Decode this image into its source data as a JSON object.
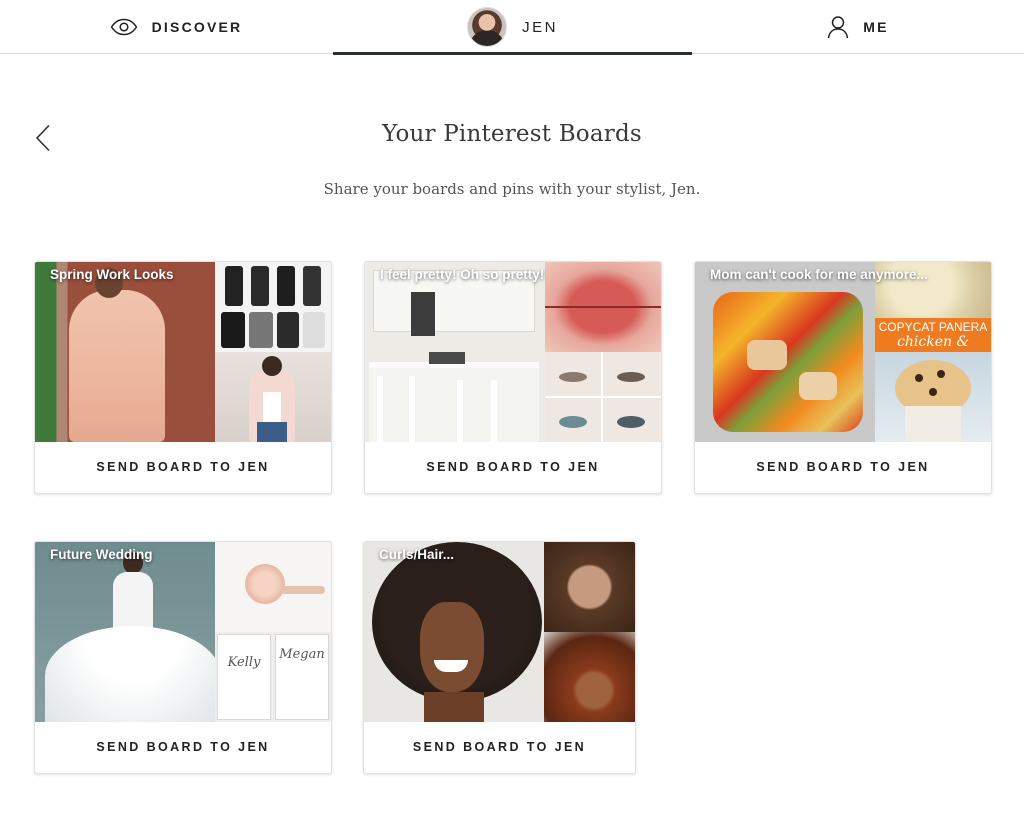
{
  "nav": {
    "discover_label": "DISCOVER",
    "jen_label": "JEN",
    "me_label": "ME",
    "discover_icon": "eye-icon",
    "me_icon": "person-icon",
    "active_tab": "JEN"
  },
  "header": {
    "title": "Your Pinterest Boards",
    "subtitle": "Share your boards and pins with your stylist, Jen.",
    "back_icon": "chevron-left-icon"
  },
  "boards": [
    {
      "name": "Spring Work Looks",
      "button_label": "SEND BOARD TO JEN"
    },
    {
      "name": "I feel pretty! Oh so pretty!",
      "button_label": "SEND BOARD TO JEN"
    },
    {
      "name": "Mom can't cook for me anymore...",
      "button_label": "SEND BOARD TO JEN",
      "image_text": "COPYCAT PANERA",
      "image_text_2": "chicken &"
    },
    {
      "name": "Future Wedding",
      "button_label": "SEND BOARD TO JEN",
      "image_text": "Kelly",
      "image_text_2": "Megan"
    },
    {
      "name": "Curls/Hair...",
      "button_label": "SEND BOARD TO JEN"
    }
  ],
  "colors": {
    "active_underline": "#2c2f33",
    "card_border": "#e2e2e2",
    "text": "#222222"
  }
}
